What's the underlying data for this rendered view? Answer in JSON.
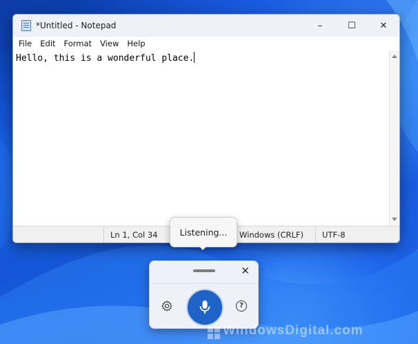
{
  "window": {
    "title": "*Untitled - Notepad",
    "controls": {
      "minimize": "–",
      "maximize": "☐",
      "close": "✕"
    }
  },
  "menu": [
    "File",
    "Edit",
    "Format",
    "View",
    "Help"
  ],
  "editor": {
    "text": "Hello, this is a wonderful place."
  },
  "status": {
    "position": "Ln 1, Col 34",
    "line_ending": "Windows (CRLF)",
    "encoding": "UTF-8"
  },
  "voice_typing": {
    "status": "Listening...",
    "close": "✕",
    "help": "?"
  },
  "watermark": "WindowsDigital.com",
  "colors": {
    "mic": "#1f63c6",
    "wallpaper": "#0b46c4"
  }
}
